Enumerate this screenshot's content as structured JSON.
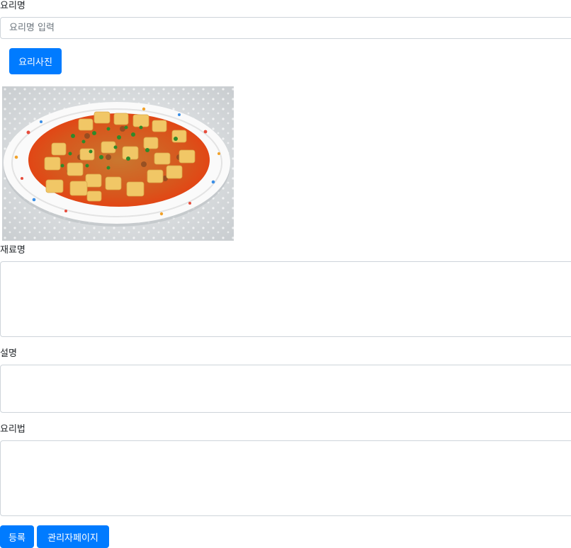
{
  "form": {
    "dish_name_label": "요리명",
    "dish_name_placeholder": "요리명 입력",
    "dish_name_value": "",
    "photo_button_label": "요리사진",
    "photo_icon": "food-photo-mapo-tofu",
    "ingredients_label": "재료명",
    "ingredients_value": "",
    "description_label": "설명",
    "description_value": "",
    "recipe_label": "요리법",
    "recipe_value": ""
  },
  "actions": {
    "register_label": "등록",
    "admin_label": "관리자페이지"
  },
  "colors": {
    "primary": "#007bff",
    "border": "#ced4da"
  }
}
